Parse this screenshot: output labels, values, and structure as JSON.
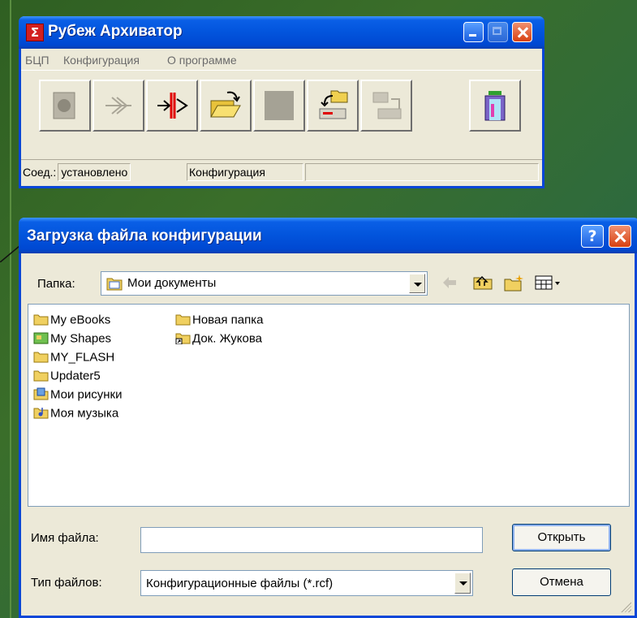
{
  "archiver": {
    "title": "Рубеж Архиватор",
    "menu": [
      "БЦП",
      "Конфигурация",
      "О программе"
    ],
    "toolbar_icons": [
      "connect-icon",
      "filter-icon",
      "disconnect-icon",
      "open-folder-icon",
      "blank-icon",
      "upload-icon",
      "download-icon",
      "exit-icon"
    ],
    "status": {
      "label": "Соед.:",
      "connection": "установлено",
      "mode": "Конфигурация",
      "extra": ""
    }
  },
  "dialog": {
    "title": "Загрузка файла конфигурации",
    "help_glyph": "?",
    "folder_label": "Папка:",
    "folder_value": "Мои документы",
    "files_col1": [
      {
        "name": "My eBooks",
        "icon": "folder-icon"
      },
      {
        "name": "My Shapes",
        "icon": "shapes-folder-icon"
      },
      {
        "name": "MY_FLASH",
        "icon": "folder-icon"
      },
      {
        "name": "Updater5",
        "icon": "folder-icon"
      },
      {
        "name": "Мои рисунки",
        "icon": "pictures-folder-icon"
      },
      {
        "name": "Моя музыка",
        "icon": "music-folder-icon"
      }
    ],
    "files_col2": [
      {
        "name": "Новая папка",
        "icon": "folder-icon"
      },
      {
        "name": "Док. Жукова",
        "icon": "shortcut-folder-icon"
      }
    ],
    "filename_label": "Имя файла:",
    "filename_value": "",
    "filetype_label": "Тип файлов:",
    "filetype_value": "Конфигурационные файлы (*.rcf)",
    "open_button": "Открыть",
    "cancel_button": "Отмена"
  }
}
